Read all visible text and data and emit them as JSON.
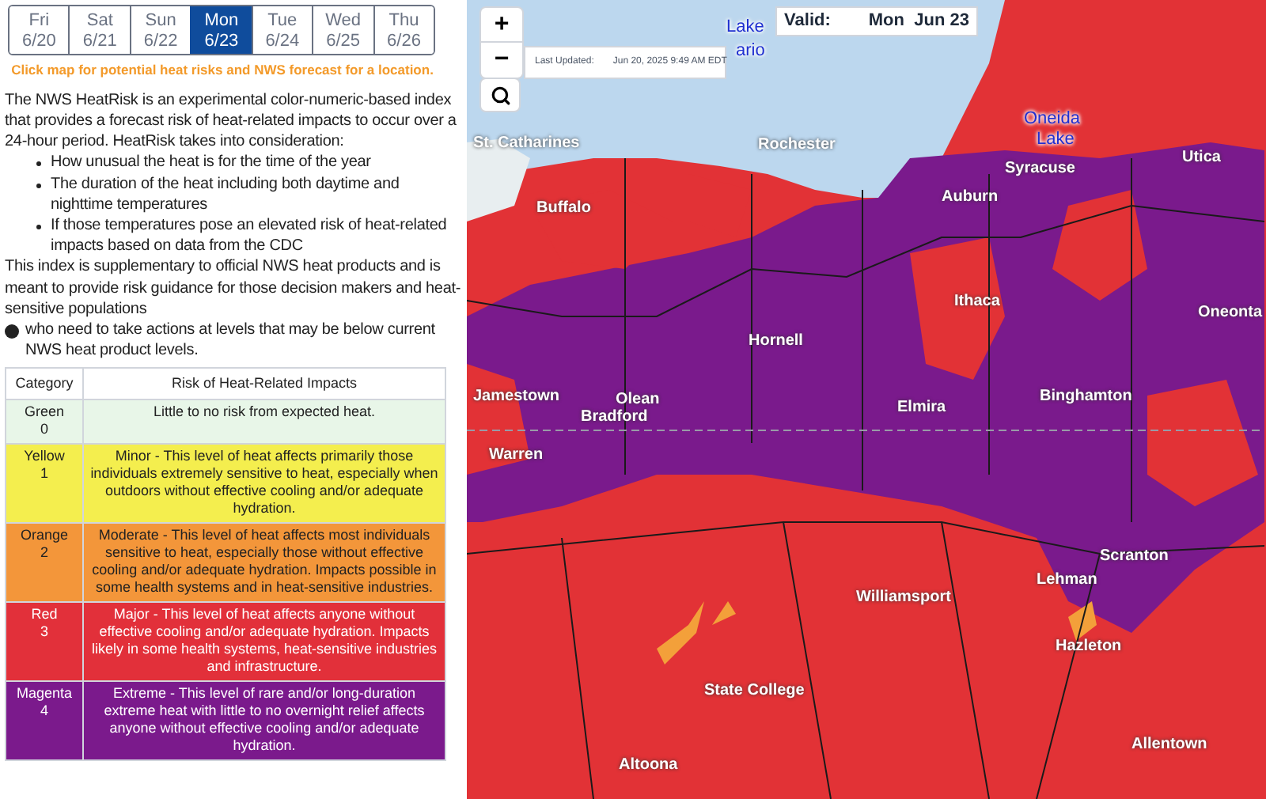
{
  "day_tabs": [
    {
      "day": "Fri",
      "date": "6/20",
      "selected": false
    },
    {
      "day": "Sat",
      "date": "6/21",
      "selected": false
    },
    {
      "day": "Sun",
      "date": "6/22",
      "selected": false
    },
    {
      "day": "Mon",
      "date": "6/23",
      "selected": true
    },
    {
      "day": "Tue",
      "date": "6/24",
      "selected": false
    },
    {
      "day": "Wed",
      "date": "6/25",
      "selected": false
    },
    {
      "day": "Thu",
      "date": "6/26",
      "selected": false
    }
  ],
  "hint": "Click map for potential heat risks and NWS forecast for a location.",
  "intro": "The NWS HeatRisk is an experimental color-numeric-based index that provides a forecast risk of heat-related impacts to occur over a 24-hour period. HeatRisk takes into consideration:",
  "bullets": [
    "How unusual the heat is for the time of the year",
    "The duration of the heat including both daytime and nighttime temperatures",
    "If those temperatures pose an elevated risk of heat-related impacts based on data from the CDC"
  ],
  "supplement_before": "This index is supplementary to official NWS heat products and is meant to provide risk guidance for those decision makers and heat-sensitive populations",
  "supplement_after": "who need to take actions at levels that may be below current NWS heat product levels.",
  "table": {
    "columns": [
      "Category",
      "Risk of Heat-Related Impacts"
    ],
    "rows": [
      {
        "category": "Green",
        "level_number": "0",
        "color": "#e8f6e8",
        "impact": "Little to no risk from expected heat."
      },
      {
        "category": "Yellow",
        "level_number": "1",
        "color": "#f4ee4e",
        "impact": "Minor - This level of heat affects primarily those individuals extremely sensitive to heat, especially when outdoors without effective cooling and/or adequate hydration."
      },
      {
        "category": "Orange",
        "level_number": "2",
        "color": "#f3963a",
        "impact": "Moderate - This level of heat affects most individuals sensitive to heat, especially those without effective cooling and/or adequate hydration. Impacts possible in some health systems and in heat-sensitive industries."
      },
      {
        "category": "Red",
        "level_number": "3",
        "color": "#e2303a",
        "impact": "Major - This level of heat affects anyone without effective cooling and/or adequate hydration. Impacts likely in some health systems, heat-sensitive industries and infrastructure."
      },
      {
        "category": "Magenta",
        "level_number": "4",
        "color": "#7b1a8c",
        "impact": "Extreme - This level of rare and/or long-duration extreme heat with little to no overnight relief affects anyone without effective cooling and/or adequate hydration."
      }
    ]
  },
  "map": {
    "zoom_in": "+",
    "zoom_out": "−",
    "valid_label": "Valid:",
    "valid_value": "Mon  Jun 23",
    "last_updated_label": "Last Updated:",
    "last_updated_value": "Jun 20, 2025 9:49 AM EDT",
    "water_labels": [
      "Lake",
      "ario",
      "Oneida",
      "Lake"
    ],
    "places": [
      "St. Catharines",
      "Rochester",
      "Syracuse",
      "Utica",
      "Auburn",
      "Buffalo",
      "Ithaca",
      "Oneonta",
      "Hornell",
      "Jamestown",
      "Olean",
      "Elmira",
      "Binghamton",
      "Bradford",
      "Warren",
      "Scranton",
      "Lehman",
      "Williamsport",
      "Hazleton",
      "State College",
      "Allentown",
      "Altoona"
    ]
  }
}
